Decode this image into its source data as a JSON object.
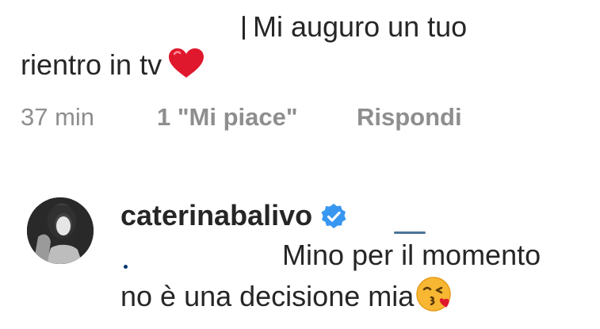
{
  "comment": {
    "text_line1": "Mi auguro un tuo",
    "text_line2": "rientro in tv",
    "emoji": "heart-icon",
    "time": "37 min",
    "likes": "1 \"Mi piace\"",
    "reply_label": "Rispondi"
  },
  "reply": {
    "username": "caterinabalivo",
    "verified": true,
    "text_line1": "Mino per il momento",
    "text_line2": "no è una decisione mia",
    "emoji": "kissing-face-icon"
  },
  "colors": {
    "text": "#262626",
    "meta": "#8e8e8e",
    "verified_blue": "#3897f0",
    "heart_red": "#e0182d",
    "mention": "#00376b"
  }
}
